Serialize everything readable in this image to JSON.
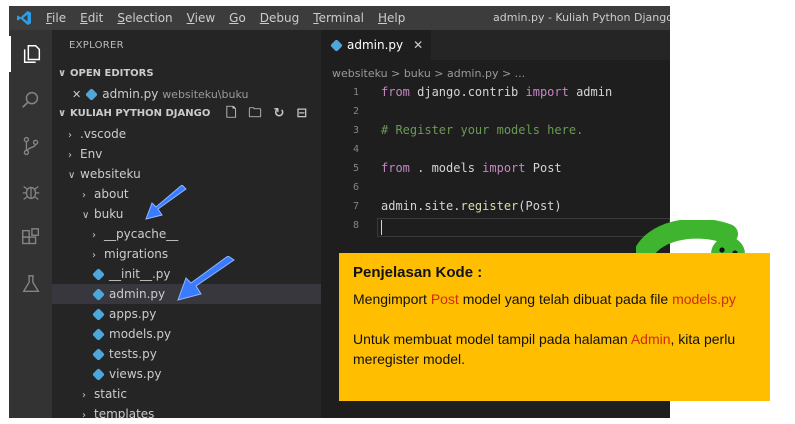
{
  "menubar": {
    "items": [
      {
        "u": "F",
        "rest": "ile"
      },
      {
        "u": "E",
        "rest": "dit"
      },
      {
        "u": "S",
        "rest": "election"
      },
      {
        "u": "V",
        "rest": "iew"
      },
      {
        "u": "G",
        "rest": "o"
      },
      {
        "u": "D",
        "rest": "ebug"
      },
      {
        "u": "T",
        "rest": "erminal"
      },
      {
        "u": "H",
        "rest": "elp"
      }
    ],
    "window_title": "admin.py - Kuliah Python Django - Vi"
  },
  "sidebar": {
    "title": "EXPLORER",
    "open_editors_label": "OPEN EDITORS",
    "open_editor_file": "admin.py",
    "open_editor_path": "websiteku\\buku",
    "close_glyph": "✕",
    "project_label": "KULIAH PYTHON DJANGO",
    "tree": [
      {
        "label": ".vscode",
        "type": "folder",
        "expanded": false
      },
      {
        "label": "Env",
        "type": "folder",
        "expanded": false
      },
      {
        "label": "websiteku",
        "type": "folder",
        "expanded": true
      },
      {
        "label": "about",
        "type": "folder",
        "expanded": false
      },
      {
        "label": "buku",
        "type": "folder",
        "expanded": true
      },
      {
        "label": "__pycache__",
        "type": "folder",
        "expanded": false
      },
      {
        "label": "migrations",
        "type": "folder",
        "expanded": false
      },
      {
        "label": "__init__.py",
        "type": "python-file"
      },
      {
        "label": "admin.py",
        "type": "python-file",
        "selected": true
      },
      {
        "label": "apps.py",
        "type": "python-file"
      },
      {
        "label": "models.py",
        "type": "python-file"
      },
      {
        "label": "tests.py",
        "type": "python-file"
      },
      {
        "label": "views.py",
        "type": "python-file"
      },
      {
        "label": "static",
        "type": "folder",
        "expanded": false
      },
      {
        "label": "templates",
        "type": "folder",
        "expanded": false
      }
    ]
  },
  "editor": {
    "tab_label": "admin.py",
    "tab_close": "✕",
    "breadcrumb": "websiteku > buku > admin.py > ...",
    "line_numbers": [
      "1",
      "2",
      "3",
      "4",
      "5",
      "6",
      "7",
      "8"
    ],
    "code": {
      "l1_kw1": "from",
      "l1_mod": " django.contrib ",
      "l1_kw2": "import",
      "l1_name": " admin",
      "l3_comment": "# Register your models here.",
      "l5_kw1": "from",
      "l5_mod": " . models ",
      "l5_kw2": "import",
      "l5_name": " Post",
      "l7_obj": "admin.site.",
      "l7_fn": "register",
      "l7_arg": "(Post)"
    }
  },
  "card": {
    "title": "Penjelasan Kode :",
    "p1_a": "Mengimport ",
    "p1_red1": "Post",
    "p1_b": " model yang telah dibuat pada file ",
    "p1_red2": "models.py",
    "p2_a": "Untuk membuat model tampil pada halaman ",
    "p2_red": "Admin",
    "p2_b": ", kita perlu meregister model."
  },
  "colors": {
    "card_bg": "#ffbf00",
    "highlight_red": "#d32a0e",
    "arrow_blue": "#3b7bff",
    "snake_green": "#3fb52f"
  },
  "icons": [
    "vscode-logo-icon",
    "files-icon",
    "search-icon",
    "source-control-icon",
    "debug-icon",
    "extensions-icon",
    "test-flask-icon",
    "new-file-icon",
    "new-folder-icon",
    "refresh-icon",
    "collapse-all-icon",
    "chevron-right-icon",
    "chevron-down-icon",
    "python-file-icon",
    "pointer-arrow-icon",
    "snake-mascot-icon"
  ]
}
